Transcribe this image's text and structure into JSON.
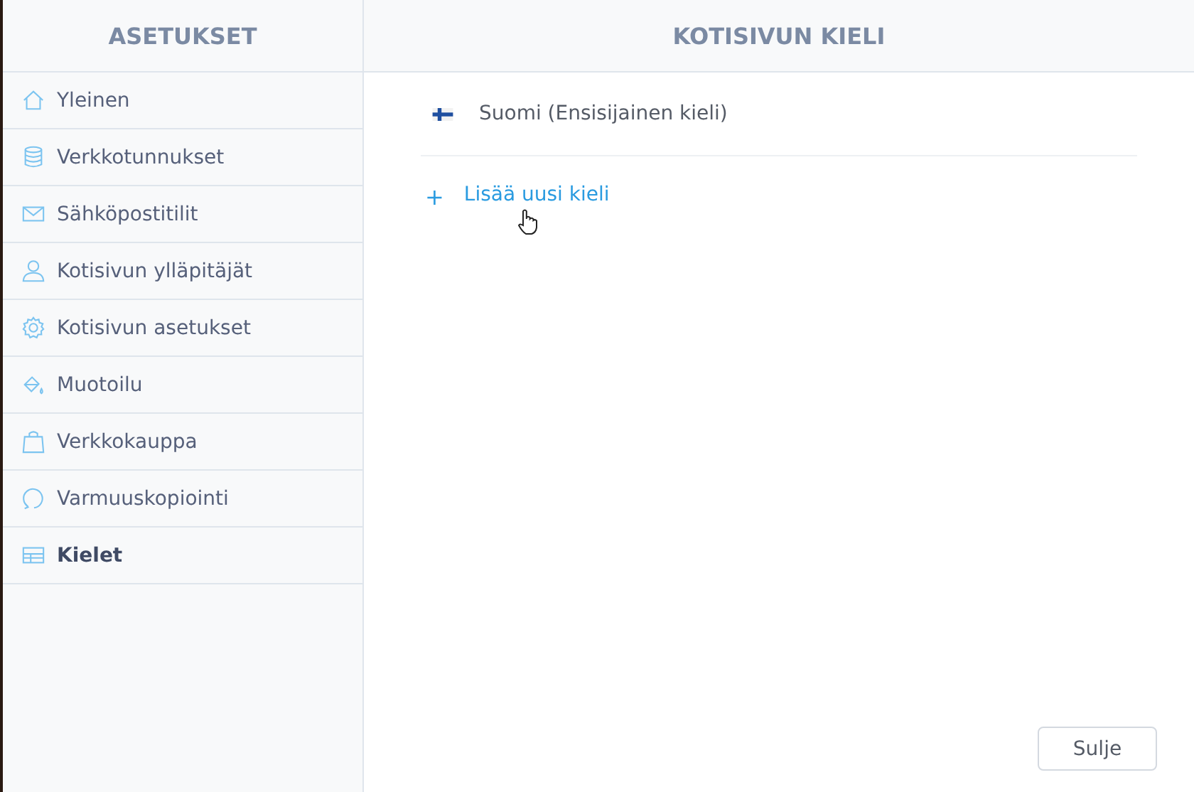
{
  "sidebar": {
    "title": "ASETUKSET",
    "items": [
      {
        "label": "Yleinen",
        "kind": "home",
        "selected": false
      },
      {
        "label": "Verkkotunnukset",
        "kind": "database",
        "selected": false
      },
      {
        "label": "Sähköpostitilit",
        "kind": "mail",
        "selected": false
      },
      {
        "label": "Kotisivun ylläpitäjät",
        "kind": "user",
        "selected": false
      },
      {
        "label": "Kotisivun asetukset",
        "kind": "gear",
        "selected": false
      },
      {
        "label": "Muotoilu",
        "kind": "paint",
        "selected": false
      },
      {
        "label": "Verkkokauppa",
        "kind": "bag",
        "selected": false
      },
      {
        "label": "Varmuuskopiointi",
        "kind": "refresh",
        "selected": false
      },
      {
        "label": "Kielet",
        "kind": "layout",
        "selected": true
      }
    ]
  },
  "main": {
    "title": "KOTISIVUN KIELI",
    "languages": [
      {
        "label": "Suomi (Ensisijainen kieli)"
      }
    ],
    "add_link": {
      "icon": "+",
      "label": "Lisää uusi kieli"
    },
    "close_button": "Sulje"
  }
}
